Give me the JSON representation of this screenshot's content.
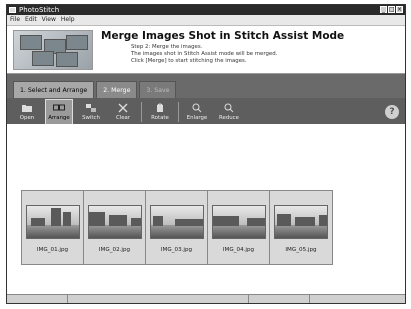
{
  "window": {
    "title": "PhotoStitch",
    "controls": [
      "_",
      "□",
      "×"
    ]
  },
  "menu": [
    "File",
    "Edit",
    "View",
    "Help"
  ],
  "header": {
    "title": "Merge Images Shot in Stitch Assist Mode",
    "lines": [
      "Step 2: Merge the images.",
      "The images shot in Stitch Assist mode will be merged.",
      "Click [Merge] to start stitching the images."
    ]
  },
  "tabs": [
    {
      "label": "1. Select and Arrange",
      "state": "active"
    },
    {
      "label": "2. Merge",
      "state": "normal"
    },
    {
      "label": "3. Save",
      "state": "disabled"
    }
  ],
  "toolbar": {
    "items": [
      {
        "label": "Open",
        "icon": "open-icon",
        "selected": false
      },
      {
        "label": "Arrange",
        "icon": "arrange-icon",
        "selected": true
      },
      {
        "label": "Switch",
        "icon": "switch-icon",
        "selected": false
      },
      {
        "label": "Clear",
        "icon": "clear-icon",
        "selected": false
      },
      {
        "label": "Rotate",
        "icon": "rotate-icon",
        "selected": false
      },
      {
        "label": "Enlarge",
        "icon": "enlarge-icon",
        "selected": false
      },
      {
        "label": "Reduce",
        "icon": "reduce-icon",
        "selected": false
      }
    ],
    "help": "?"
  },
  "images": [
    {
      "name": "IMG_01.jpg"
    },
    {
      "name": "IMG_02.jpg"
    },
    {
      "name": "IMG_03.jpg"
    },
    {
      "name": "IMG_04.jpg"
    },
    {
      "name": "IMG_05.jpg"
    }
  ]
}
